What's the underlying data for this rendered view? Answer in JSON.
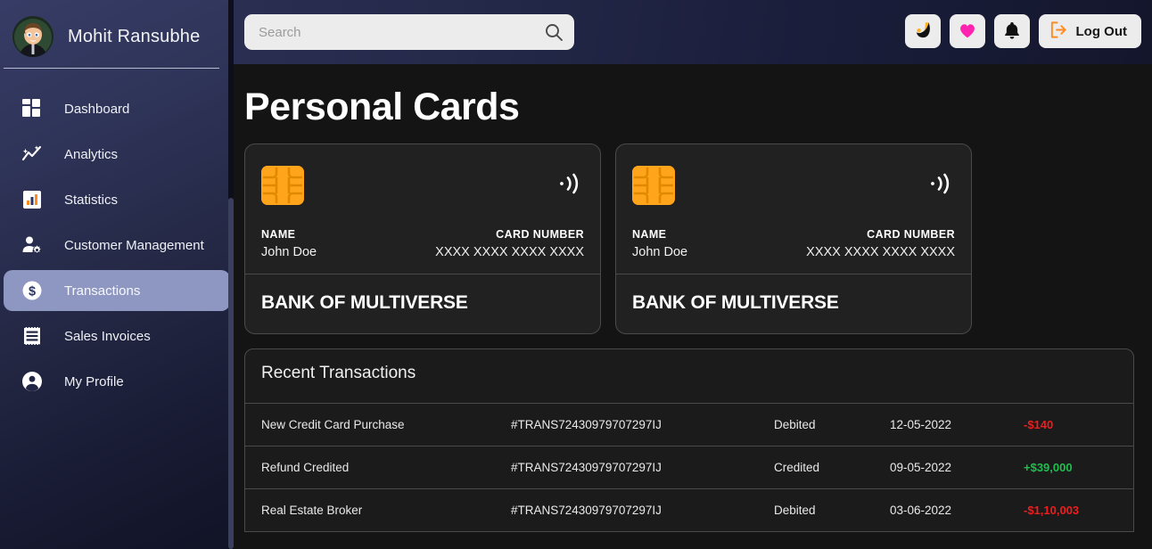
{
  "sidebar": {
    "profile": {
      "name": "Mohit Ransubhe",
      "avatar_icon": "user-avatar"
    },
    "items": [
      {
        "label": "Dashboard",
        "icon": "dashboard-grid-icon",
        "active": false
      },
      {
        "label": "Analytics",
        "icon": "analytics-line-chart-icon",
        "active": false
      },
      {
        "label": "Statistics",
        "icon": "statistics-bar-chart-icon",
        "active": false
      },
      {
        "label": "Customer Management",
        "icon": "user-gear-icon",
        "active": false
      },
      {
        "label": "Transactions",
        "icon": "dollar-coin-icon",
        "active": true
      },
      {
        "label": "Sales Invoices",
        "icon": "receipt-invoice-icon",
        "active": false
      },
      {
        "label": "My Profile",
        "icon": "user-circle-icon",
        "active": false
      }
    ]
  },
  "topbar": {
    "search": {
      "value": "",
      "placeholder": "Search",
      "icon": "search-icon"
    },
    "actions": [
      {
        "name": "dark-mode-toggle",
        "icon": "crescent-moon-icon"
      },
      {
        "name": "favorites-button",
        "icon": "heart-icon",
        "color": "#ff23b0"
      },
      {
        "name": "notifications-button",
        "icon": "bell-icon"
      }
    ],
    "logout": {
      "label": "Log Out",
      "icon": "logout-arrow-icon",
      "icon_color": "#ff8a1e"
    }
  },
  "main": {
    "page_title": "Personal Cards",
    "cards": [
      {
        "chip_icon": "emv-chip-icon",
        "contactless_icon": "contactless-wave-icon",
        "name_label": "NAME",
        "name_value": "John Doe",
        "number_label": "CARD NUMBER",
        "number_value": "XXXX XXXX XXXX XXXX",
        "bank": "BANK OF MULTIVERSE"
      },
      {
        "chip_icon": "emv-chip-icon",
        "contactless_icon": "contactless-wave-icon",
        "name_label": "NAME",
        "name_value": "John Doe",
        "number_label": "CARD NUMBER",
        "number_value": "XXXX XXXX XXXX XXXX",
        "bank": "BANK OF MULTIVERSE"
      }
    ],
    "transactions": {
      "title": "Recent Transactions",
      "rows": [
        {
          "description": "New Credit Card Purchase",
          "reference": "#TRANS72430979707297IJ",
          "type": "Debited",
          "date": "12-05-2022",
          "amount": "-$140",
          "amount_sign": "negative"
        },
        {
          "description": "Refund Credited",
          "reference": "#TRANS72430979707297IJ",
          "type": "Credited",
          "date": "09-05-2022",
          "amount": "+$39,000",
          "amount_sign": "positive"
        },
        {
          "description": "Real Estate Broker",
          "reference": "#TRANS72430979707297IJ",
          "type": "Debited",
          "date": "03-06-2022",
          "amount": "-$1,10,003",
          "amount_sign": "negative"
        }
      ]
    }
  },
  "colors": {
    "accent_orange": "#ff8a1e",
    "chip_orange": "#ffa41b",
    "active_nav": "#8e97c2",
    "credit": "#1fbf4e",
    "debit": "#ef1d1d"
  }
}
